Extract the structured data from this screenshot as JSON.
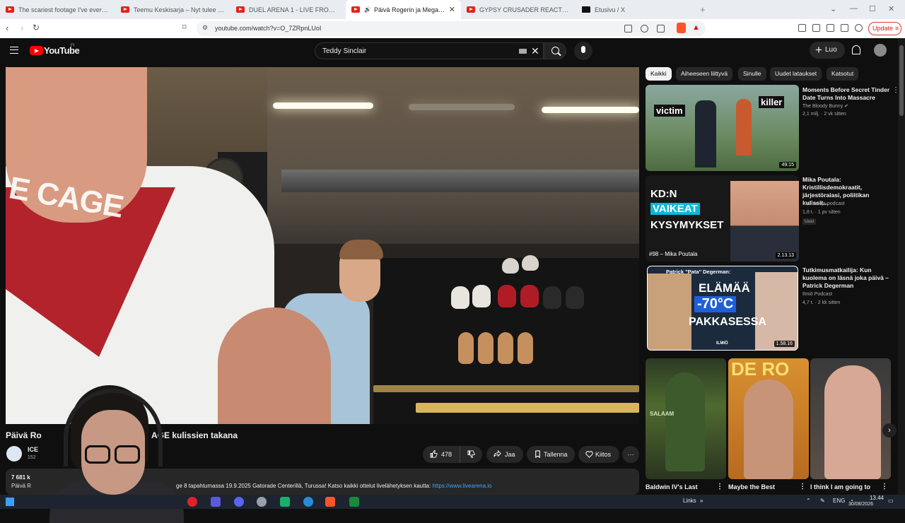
{
  "browser": {
    "tabs": [
      {
        "title": "The scariest footage I've ever seen..."
      },
      {
        "title": "Teemu Keskisarja – Nyt tulee täysilaid..."
      },
      {
        "title": "DUEL ARENA 1 - LIVE FROM ORLANDO"
      },
      {
        "title": "Päivä Rogerin ja Megan kanssa"
      },
      {
        "title": "GYPSY CRUSADER REACTS TO FIGHT"
      },
      {
        "title": "Etusivu / X"
      }
    ],
    "url": "youtube.com/watch?v=O_7ZRpnLUoI",
    "update_label": "Update"
  },
  "youtube": {
    "logo_text": "YouTube",
    "country_code": "FI",
    "search_value": "Teddy Sinclair",
    "create_label": "Luo"
  },
  "video": {
    "title_visible_start": "Päivä Ro",
    "title_visible_end": "AGE kulissien takana",
    "overlay_text": "E CAGE",
    "channel_name": "ICE",
    "channel_subs": "152",
    "like_count": "478",
    "share_label": "Jaa",
    "save_label": "Tallenna",
    "thanks_label": "Kiitos",
    "more_label": "···",
    "desc_views": "7 681 k",
    "desc_line_start": "Päivä R",
    "desc_text": "ge 8 tapahtumassa 19.9.2025 Gatorade Centerillä, Turussa! Katso kaikki ottelut livelähetyksen kautta: ",
    "desc_link": "https://www.livearena.io"
  },
  "chips": [
    "Kaikki",
    "Aiheeseen liittyvä",
    "Sinulle",
    "Uudet lataukset",
    "Katsotut"
  ],
  "recommended": [
    {
      "title": "Moments Before Secret Tinder Date Turns Into Massacre",
      "channel": "The Bloody Bunny",
      "meta": "2,1 milj. · 2 vk sitten",
      "duration": "49:15",
      "thumb_left": "victim",
      "thumb_right": "killer"
    },
    {
      "title": "Mika Poutala: Kristillisdemokraatit, järjestöraiasi, poliitikan kulissit...",
      "channel": "Kuunnelija-podcast",
      "meta": "1,8 t. · 1 pv sitten",
      "duration": "2.13.13",
      "badge": "Uusi",
      "thumb_line1": "KD:N",
      "thumb_line2": "VAIKEAT",
      "thumb_line3": "KYSYMYKSET",
      "thumb_caption": "#98 – Mika Poutala"
    },
    {
      "title": "Tutkimusmatkailija: Kun kuolema on läsnä joka päivä – Patrick Degerman",
      "channel": "Ilmiö Podcast",
      "meta": "4,7 t. · 2 kk sitten",
      "duration": "1.58.16",
      "thumb_header": "Patrick \"Pata\" Degerman:",
      "thumb_line1": "ELÄMÄÄ",
      "thumb_line2": "-70°C",
      "thumb_line3": "PAKKASESSA",
      "thumb_brand": "ILMIÖ"
    }
  ],
  "shorts": [
    {
      "title": "Baldwin IV's Last",
      "thumb_text": "SALAAM"
    },
    {
      "title": "Maybe the Best",
      "thumb_text": "DE RO"
    },
    {
      "title": "I think I am going to",
      "thumb_text": ""
    }
  ],
  "taskbar": {
    "links_label": "Links",
    "lang": "ENG",
    "time": "13.44",
    "date": "30/08/2026"
  }
}
